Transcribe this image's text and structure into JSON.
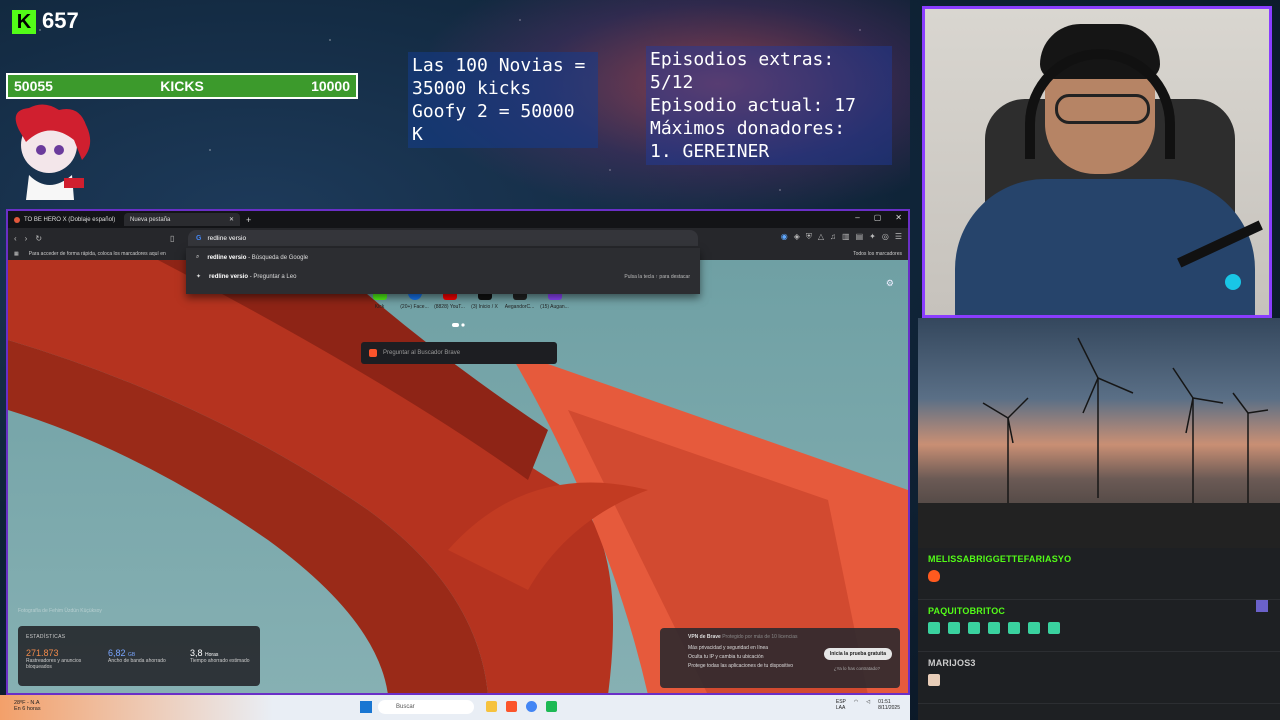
{
  "overlay": {
    "kick_count": "657",
    "goal": {
      "current": "50055",
      "label": "KICKS",
      "target": "10000"
    },
    "info_left": [
      "Las 100 Novias =",
      "35000 kicks",
      "Goofy 2 = 50000 K"
    ],
    "info_right": [
      "Episodios extras: 5/12",
      "Episodio actual: 17",
      "Máximos donadores:",
      "1. GEREINER"
    ]
  },
  "chat": {
    "messages": [
      {
        "user": "MELISSABRIGGETTEFARIASYO",
        "user_color": "#53fc18",
        "emotes": 1
      },
      {
        "user": "PAQUITOBRITOC",
        "user_color": "#53fc18",
        "emotes": 7
      },
      {
        "user": "MARIJOS3",
        "user_color": "#cccccc",
        "emotes": 1
      }
    ]
  },
  "browser": {
    "tabs": [
      {
        "title": "TO BE HERO X (Doblaje español)"
      },
      {
        "title": "Nueva pestaña"
      }
    ],
    "address_text": "redline versio",
    "bookmarks_hint": "Para acceder de forma rápida, coloca los marcadores aquí en",
    "all_bookmarks": "Todos los marcadores",
    "suggestions": [
      {
        "bold": "redline versio",
        "rest": " - Búsqueda de Google"
      },
      {
        "bold": "redline versio",
        "rest": " - Preguntar a Leo",
        "hint": "Pulsa la tecla ↑ para destacar"
      }
    ],
    "top_sites": [
      "Kick",
      "(20+) Face...",
      "(8828) YouT...",
      "(3) Inicio / X",
      "AegandorC...",
      "(15) Augan..."
    ],
    "ask_brave": "Preguntar al Buscador Brave",
    "photo_credit": "Fotografía de Fehim Üzdün Küçüksoy",
    "stats": {
      "title": "ESTADÍSTICAS",
      "items": [
        {
          "value": "271.873",
          "unit": "",
          "label": "Rastreadores y anuncios bloqueados",
          "color": "#f08a4b"
        },
        {
          "value": "6,82",
          "unit": "GB",
          "label": "Ancho de banda ahorrado",
          "color": "#7aa6ff"
        },
        {
          "value": "3,8",
          "unit": "Horas",
          "label": "Tiempo ahorrado estimado",
          "color": "#ffffff"
        }
      ]
    },
    "vpn": {
      "title": "VPN de Brave",
      "subtitle": "Protegido por más de 10 licencias",
      "lines": [
        "Más privacidad y seguridad en línea",
        "Oculta tu IP y cambia tu ubicación",
        "Protege todas las aplicaciones de tu dispositivo"
      ],
      "button": "Inicia la prueba gratuita",
      "dismiss": "¿Ya lo has contratado?"
    }
  },
  "taskbar": {
    "weather_temp": "28ºF - N.A",
    "weather_sub": "En 6 horas",
    "search_placeholder": "Buscar",
    "lang": "ESP",
    "lang2": "LAA",
    "time": "01:51",
    "date": "8/11/2025"
  }
}
